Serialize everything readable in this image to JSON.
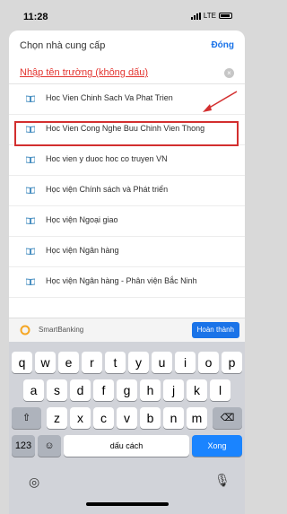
{
  "status": {
    "time": "11:28",
    "network": "LTE"
  },
  "sheet": {
    "title": "Chọn nhà cung cấp",
    "close_label": "Đóng",
    "search_placeholder": "Nhập tên trường (không dấu)"
  },
  "list": {
    "items": [
      {
        "label": "Hoc Vien Chinh Sach Va Phat Trien"
      },
      {
        "label": "Hoc Vien Cong Nghe Buu Chinh Vien Thong",
        "highlighted": true
      },
      {
        "label": "Hoc vien y duoc hoc co truyen VN"
      },
      {
        "label": "Học viện Chính sách và Phát triển"
      },
      {
        "label": "Học viện Ngoại giao"
      },
      {
        "label": "Học viện Ngân hàng"
      },
      {
        "label": "Học viện Ngân hàng - Phân viện Bắc Ninh"
      }
    ]
  },
  "toolbar": {
    "brand": "SmartBanking",
    "done_label": "Hoàn thành"
  },
  "keyboard": {
    "row1": [
      "q",
      "w",
      "e",
      "r",
      "t",
      "y",
      "u",
      "i",
      "o",
      "p"
    ],
    "row2": [
      "a",
      "s",
      "d",
      "f",
      "g",
      "h",
      "j",
      "k",
      "l"
    ],
    "row3": [
      "z",
      "x",
      "c",
      "v",
      "b",
      "n",
      "m"
    ],
    "numbers_label": "123",
    "space_label": "dấu cách",
    "enter_label": "Xong"
  },
  "colors": {
    "accent": "#1a73e8",
    "highlight": "#d32f2f",
    "icon": "#4a90c2"
  }
}
